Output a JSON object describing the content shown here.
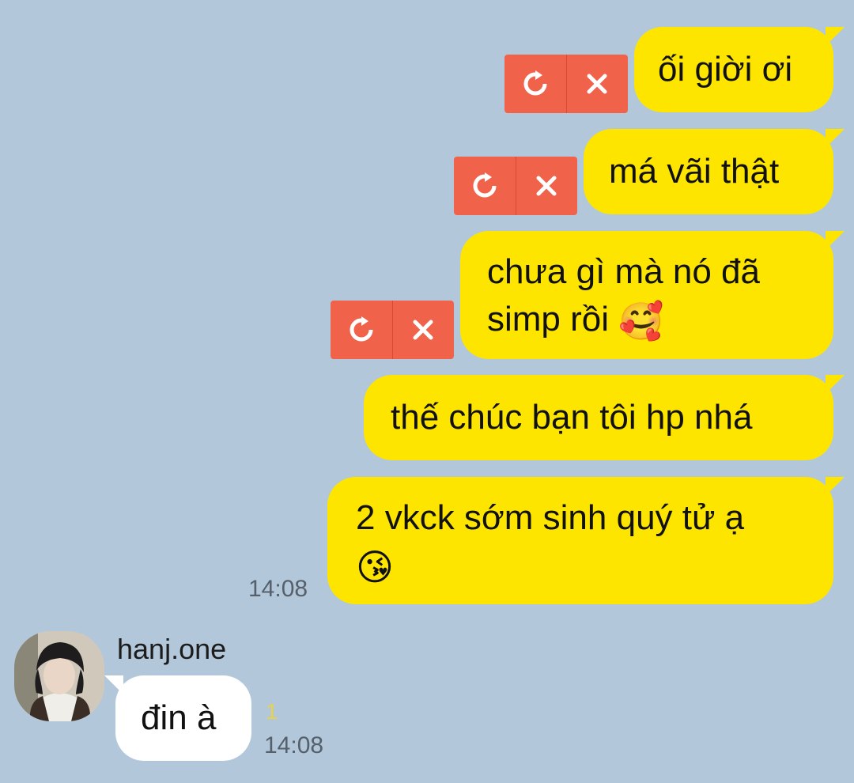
{
  "messages_out": [
    {
      "lines": [
        "ối giời ơi"
      ]
    },
    {
      "lines": [
        "má vãi thật"
      ]
    },
    {
      "lines": [
        "chưa gì mà nó đã",
        "simp rồi"
      ],
      "emoji": "🥰"
    },
    {
      "lines": [
        "thế chúc bạn tôi hp nhá"
      ]
    },
    {
      "lines": [
        "2 vkck sớm sinh quý tử ạ"
      ],
      "emoji": "😘"
    }
  ],
  "out_time": "14:08",
  "incoming": {
    "sender": "hanj.one",
    "text": "đin à",
    "unread_count": "1",
    "time": "14:08"
  },
  "icons": {
    "retry": "retry-icon",
    "delete": "close-icon"
  },
  "colors": {
    "background": "#b2c7da",
    "outgoing_bubble": "#fee500",
    "incoming_bubble": "#ffffff",
    "failed_button": "#f1624b",
    "unread_count": "#e8d24a"
  }
}
